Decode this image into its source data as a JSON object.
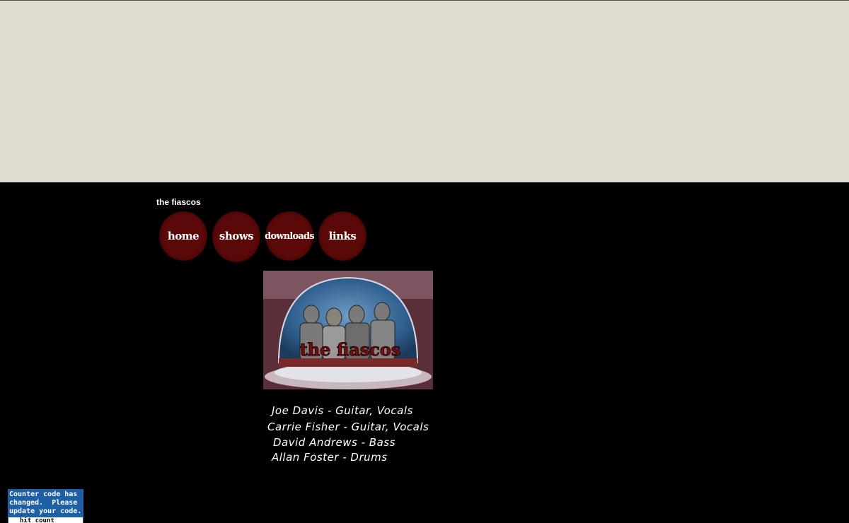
{
  "site": {
    "title": "the fiascos"
  },
  "nav": {
    "items": [
      {
        "label": "home"
      },
      {
        "label": "shows"
      },
      {
        "label": "downloads"
      },
      {
        "label": "links"
      }
    ]
  },
  "hero": {
    "band_name": "the fiascos"
  },
  "lineup": [
    {
      "text": "Joe Davis - Guitar, Vocals"
    },
    {
      "text": "Carrie Fisher - Guitar, Vocals"
    },
    {
      "text": "David Andrews - Bass"
    },
    {
      "text": "Allan Foster - Drums"
    }
  ],
  "counter": {
    "message": "Counter code has\nchanged.  Please\nupdate your code.",
    "footer": "hit count"
  },
  "colors": {
    "top_band": "#dfdbcf",
    "page_bg": "#000000",
    "nav_button": "#5a0808",
    "counter_bg": "#1f5fa3"
  }
}
